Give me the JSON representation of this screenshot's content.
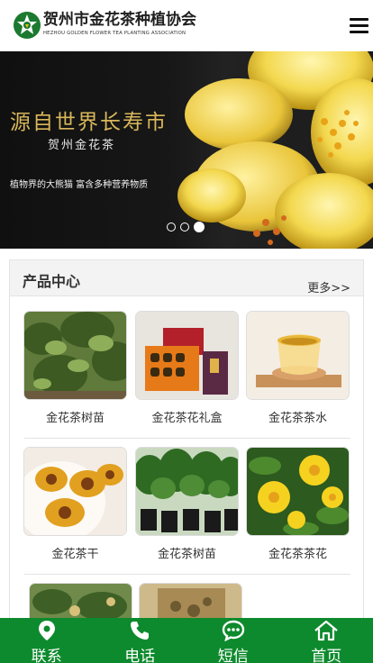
{
  "header": {
    "title_cn": "贺州市金花茶种植协会",
    "title_en": "HEZHOU GOLDEN FLOWER TEA PLANTING ASSOCIATION",
    "menu_icon": "hamburger-icon"
  },
  "banner": {
    "headline": "源自世界长寿市",
    "subtitle": "贺州金花茶",
    "tagline": "植物界的大熊猫 富含多种营养物质",
    "slides_total": 3,
    "active_slide": 3
  },
  "products": {
    "title": "产品中心",
    "more_label": "更多>>",
    "items": [
      {
        "name": "金花茶树苗"
      },
      {
        "name": "金花茶花礼盒"
      },
      {
        "name": "金花茶茶水"
      },
      {
        "name": "金花茶干"
      },
      {
        "name": "金花茶树苗"
      },
      {
        "name": "金花茶茶花"
      },
      {
        "name": ""
      },
      {
        "name": ""
      }
    ]
  },
  "bottom_nav": [
    {
      "label": "联系",
      "icon": "location-pin-icon"
    },
    {
      "label": "电话",
      "icon": "phone-icon"
    },
    {
      "label": "短信",
      "icon": "chat-bubble-icon"
    },
    {
      "label": "首页",
      "icon": "home-icon"
    }
  ],
  "colors": {
    "brand_green": "#0d8a2d",
    "banner_gold": "#d9b75a"
  }
}
